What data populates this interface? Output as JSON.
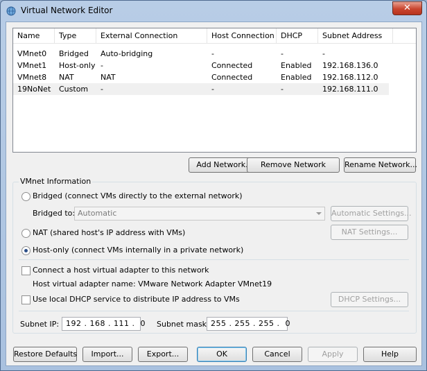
{
  "window": {
    "title": "Virtual Network Editor",
    "close_label": "✕"
  },
  "table": {
    "columns": [
      "Name",
      "Type",
      "External Connection",
      "Host Connection",
      "DHCP",
      "Subnet Address"
    ],
    "rows": [
      [
        "VMnet0",
        "Bridged",
        "Auto-bridging",
        "-",
        "-",
        "-"
      ],
      [
        "VMnet1",
        "Host-only",
        "-",
        "Connected",
        "Enabled",
        "192.168.136.0"
      ],
      [
        "VMnet8",
        "NAT",
        "NAT",
        "Connected",
        "Enabled",
        "192.168.112.0"
      ],
      [
        "19NoNet",
        "Custom",
        "-",
        "-",
        "-",
        "192.168.111.0"
      ]
    ]
  },
  "network_buttons": {
    "add": "Add Network...",
    "remove": "Remove Network",
    "rename": "Rename Network..."
  },
  "vmnet_info": {
    "title": "VMnet Information",
    "bridged_label": "Bridged (connect VMs directly to the external network)",
    "bridged_to_label": "Bridged to:",
    "bridged_to_value": "Automatic",
    "automatic_settings": "Automatic Settings...",
    "nat_label": "NAT (shared host's IP address with VMs)",
    "nat_settings": "NAT Settings...",
    "hostonly_label": "Host-only (connect VMs internally in a private network)",
    "selected_mode": "host-only",
    "connect_adapter_label": "Connect a host virtual adapter to this network",
    "adapter_name_text": "Host virtual adapter name: VMware Network Adapter VMnet19",
    "dhcp_label": "Use local DHCP service to distribute IP address to VMs",
    "dhcp_settings": "DHCP Settings...",
    "subnet_ip_label": "Subnet IP:",
    "subnet_ip_value": "192 . 168 . 111 .  0",
    "subnet_mask_label": "Subnet mask:",
    "subnet_mask_value": "255 . 255 . 255 .  0"
  },
  "footer": {
    "restore": "Restore Defaults",
    "import": "Import...",
    "export": "Export...",
    "ok": "OK",
    "cancel": "Cancel",
    "apply": "Apply",
    "help": "Help"
  }
}
